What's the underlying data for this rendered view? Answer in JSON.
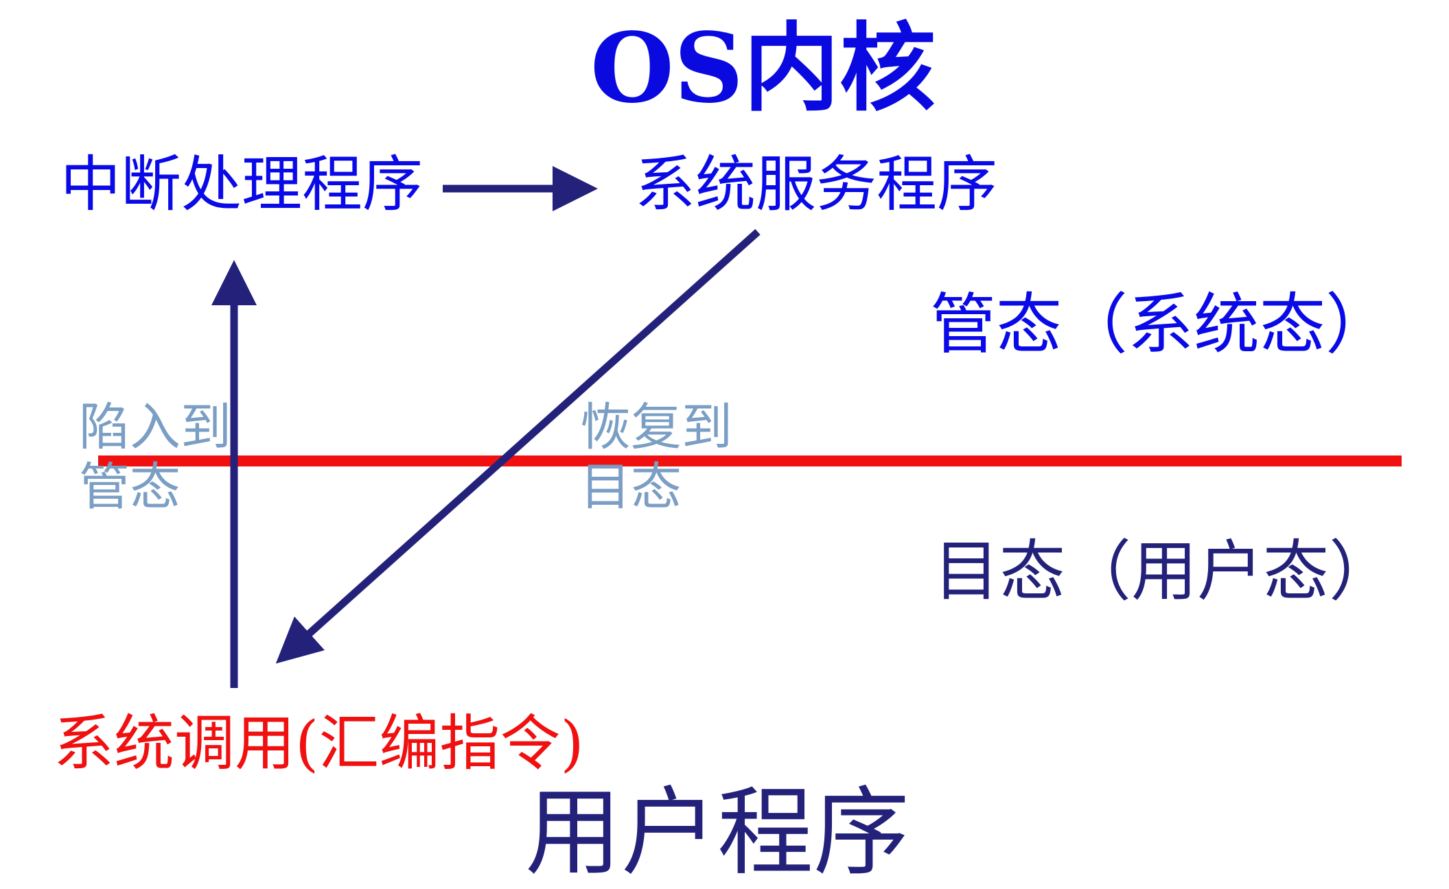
{
  "title": "OS内核",
  "nodes": {
    "interrupt_handler": "中断处理程序",
    "system_service": "系统服务程序",
    "system_call": "系统调用(汇编指令)",
    "user_program": "用户程序"
  },
  "modes": {
    "kernel_mode": "管态（系统态）",
    "user_mode": "目态（用户态）"
  },
  "transitions": {
    "trap_line1": "陷入到",
    "trap_line2": "管态",
    "restore_line1": "恢复到",
    "restore_line2": "目态"
  },
  "colors": {
    "title_blue": "#0a0ae0",
    "arrow_navy": "#23217a",
    "boundary_red": "#f01010",
    "transition_gray_blue": "#7a9ec4"
  }
}
